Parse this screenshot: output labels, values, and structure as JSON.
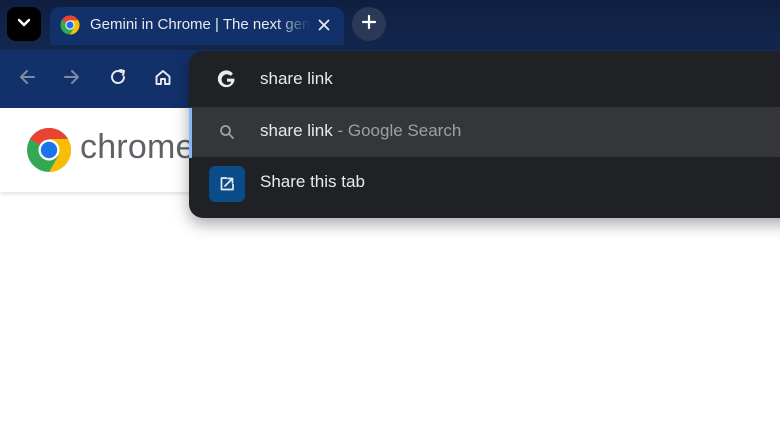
{
  "tab": {
    "title": "Gemini in Chrome | The next gen",
    "favicon": "chrome-favicon-icon"
  },
  "toolbar": {
    "back": "arrow-left-icon",
    "forward": "arrow-right-icon",
    "reload": "reload-icon",
    "home": "home-icon"
  },
  "page": {
    "logo_text": "chrome"
  },
  "omnibox": {
    "input_value": "share link",
    "suggestions": [
      {
        "query": "share link",
        "suffix": " - Google Search",
        "icon": "search-icon"
      },
      {
        "label": "Share this tab",
        "icon": "share-icon"
      }
    ]
  },
  "colors": {
    "tabstrip": "#0e1e3f",
    "toolbar": "#12306a",
    "dropdown": "#202124",
    "selected_row": "#35363a",
    "share_badge": "#0a4c8a"
  }
}
